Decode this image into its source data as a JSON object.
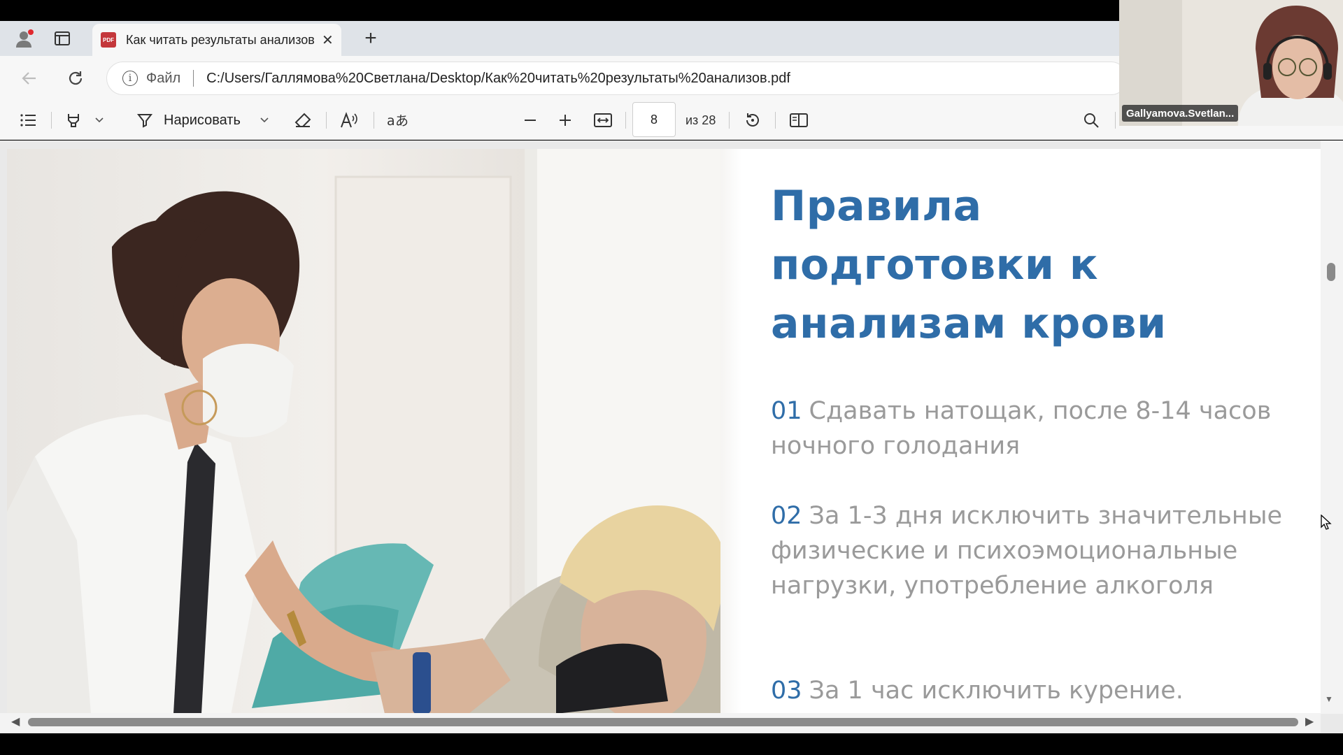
{
  "browser": {
    "tab": {
      "title": "Как читать результаты анализов.pdf",
      "close": "✕"
    },
    "new_tab": "+",
    "address": {
      "file_label": "Файл",
      "url": "C:/Users/Галлямова%20Светлана/Desktop/Как%20читать%20результаты%20анализов.pdf"
    }
  },
  "pdf_toolbar": {
    "draw_label": "Нарисовать",
    "page_current": "8",
    "page_total": "из 28"
  },
  "slide": {
    "title": "Правила подготовки к анализам крови",
    "rules": [
      {
        "num": "01",
        "text": "Сдавать натощак, после 8-14 часов ночного голодания"
      },
      {
        "num": "02",
        "text": "За 1-3 дня исключить значительные физические и психоэмоциональные нагрузки, употребление алкоголя"
      },
      {
        "num": "03",
        "text": "За 1 час исключить курение."
      }
    ]
  },
  "webcam": {
    "participant_name": "Gallyamova.Svetlan..."
  },
  "colors": {
    "title_blue": "#2f6da8",
    "rule_gray": "#9a9a9a"
  }
}
